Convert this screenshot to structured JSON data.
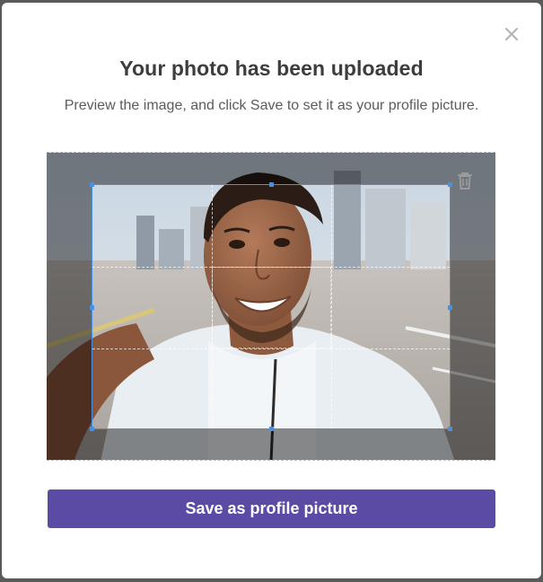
{
  "dialog": {
    "title": "Your photo has been uploaded",
    "subtitle": "Preview the image, and click Save to set it as your profile picture.",
    "close_icon": "close-icon"
  },
  "preview": {
    "image_description_icon": "profile-photo",
    "delete_icon": "trash-icon"
  },
  "actions": {
    "save_label": "Save as profile picture"
  },
  "colors": {
    "accent": "#5b4ba5",
    "crop_border": "#4a90e2",
    "title": "#3d3d3d",
    "subtitle": "#5c5c5c"
  }
}
